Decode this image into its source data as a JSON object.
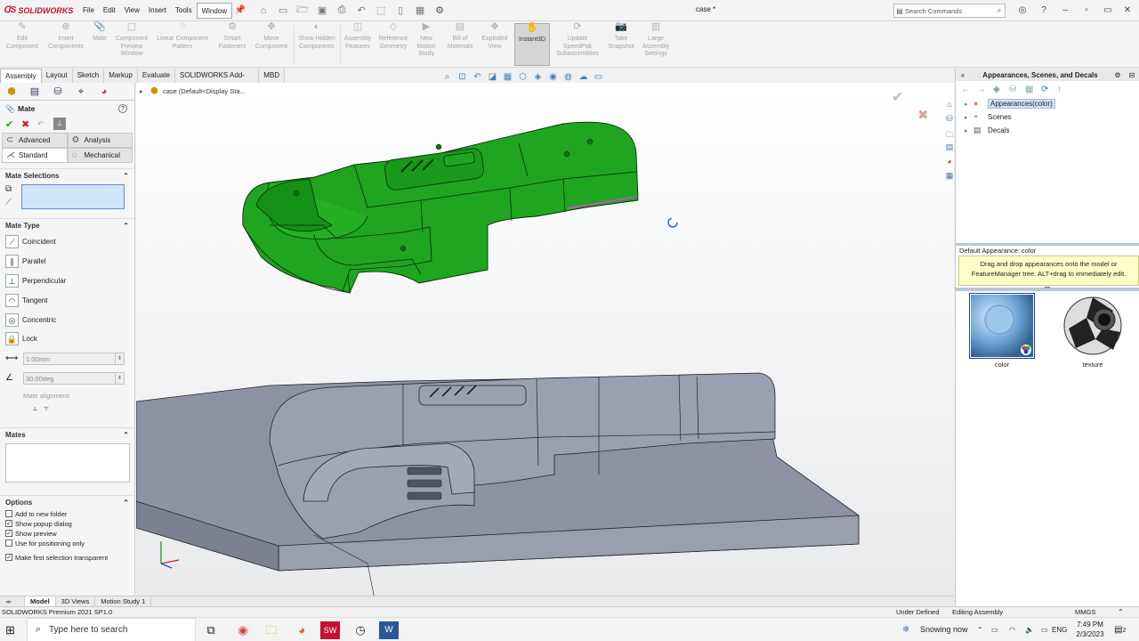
{
  "app": {
    "logo": "SOLIDWORKS",
    "document_title": "case *",
    "menu": [
      "File",
      "Edit",
      "View",
      "Insert",
      "Tools",
      "Window"
    ],
    "active_menu": "Window",
    "search_placeholder": "Search Commands"
  },
  "command_manager": [
    {
      "label": "Edit Component"
    },
    {
      "label": "Insert Components"
    },
    {
      "label": "Mate"
    },
    {
      "label": "Component Preview Window"
    },
    {
      "label": "Linear Component Pattern"
    },
    {
      "label": "Smart Fasteners"
    },
    {
      "label": "Move Component"
    },
    {
      "label": "Show Hidden Components"
    },
    {
      "label": "Assembly Features"
    },
    {
      "label": "Reference Geometry"
    },
    {
      "label": "New Motion Study"
    },
    {
      "label": "Bill of Materials"
    },
    {
      "label": "Exploded View"
    },
    {
      "label": "Instant3D"
    },
    {
      "label": "Update SpeedPak Subassemblies"
    },
    {
      "label": "Take Snapshot"
    },
    {
      "label": "Large Assembly Settings"
    }
  ],
  "tabs": [
    "Assembly",
    "Layout",
    "Sketch",
    "Markup",
    "Evaluate",
    "SOLIDWORKS Add-Ins",
    "MBD"
  ],
  "active_tab": "Assembly",
  "property_manager": {
    "title": "Mate",
    "mode_tabs": {
      "advanced": "Advanced",
      "analysis": "Analysis",
      "standard": "Standard",
      "mechanical": "Mechanical"
    },
    "mate_selections_label": "Mate Selections",
    "mate_type_label": "Mate Type",
    "mate_types": [
      "Coincident",
      "Parallel",
      "Perpendicular",
      "Tangent",
      "Concentric",
      "Lock"
    ],
    "distance_value": "1.00mm",
    "angle_value": "30.00deg",
    "mate_alignment_label": "Mate alignment:",
    "mates_label": "Mates",
    "options_label": "Options",
    "options": [
      {
        "label": "Add to new folder",
        "checked": false
      },
      {
        "label": "Show popup dialog",
        "checked": true
      },
      {
        "label": "Show preview",
        "checked": true
      },
      {
        "label": "Use for positioning only",
        "checked": false
      },
      {
        "label": "Make first selection transparent",
        "checked": true
      }
    ]
  },
  "viewport": {
    "tree_root": "case  (Default<Display Sta..."
  },
  "task_pane": {
    "title": "Appearances, Scenes, and Decals",
    "tree": [
      {
        "label": "Appearances(color)",
        "selected": true,
        "icon": "appearances-sphere-icon"
      },
      {
        "label": "Scenes",
        "selected": false,
        "icon": "scenes-icon"
      },
      {
        "label": "Decals",
        "selected": false,
        "icon": "decals-icon"
      }
    ],
    "default_appearance": "Default Appearance: color",
    "hint": "Drag and drop appearances onto the model or FeatureManager tree.  ALT+drag to immediately edit.",
    "thumbnails": [
      {
        "label": "color",
        "selected": true
      },
      {
        "label": "texture",
        "selected": false
      }
    ]
  },
  "bottom_tabs": [
    "Model",
    "3D Views",
    "Motion Study 1"
  ],
  "active_bottom_tab": "Model",
  "status": {
    "product": "SOLIDWORKS Premium 2021 SP1.0",
    "definition": "Under Defined",
    "mode": "Editing Assembly",
    "units": "MMGS"
  },
  "taskbar": {
    "search_placeholder": "Type here to search",
    "weather": "Snowing now",
    "language": "ENG",
    "time": "7:49 PM",
    "date": "2/3/2023",
    "notifications": "2"
  },
  "colors": {
    "part_green": "#1fa51f",
    "mold_gray": "#8e93a3",
    "selection_blue": "#cfe6fb",
    "accent_red": "#c8102e"
  }
}
